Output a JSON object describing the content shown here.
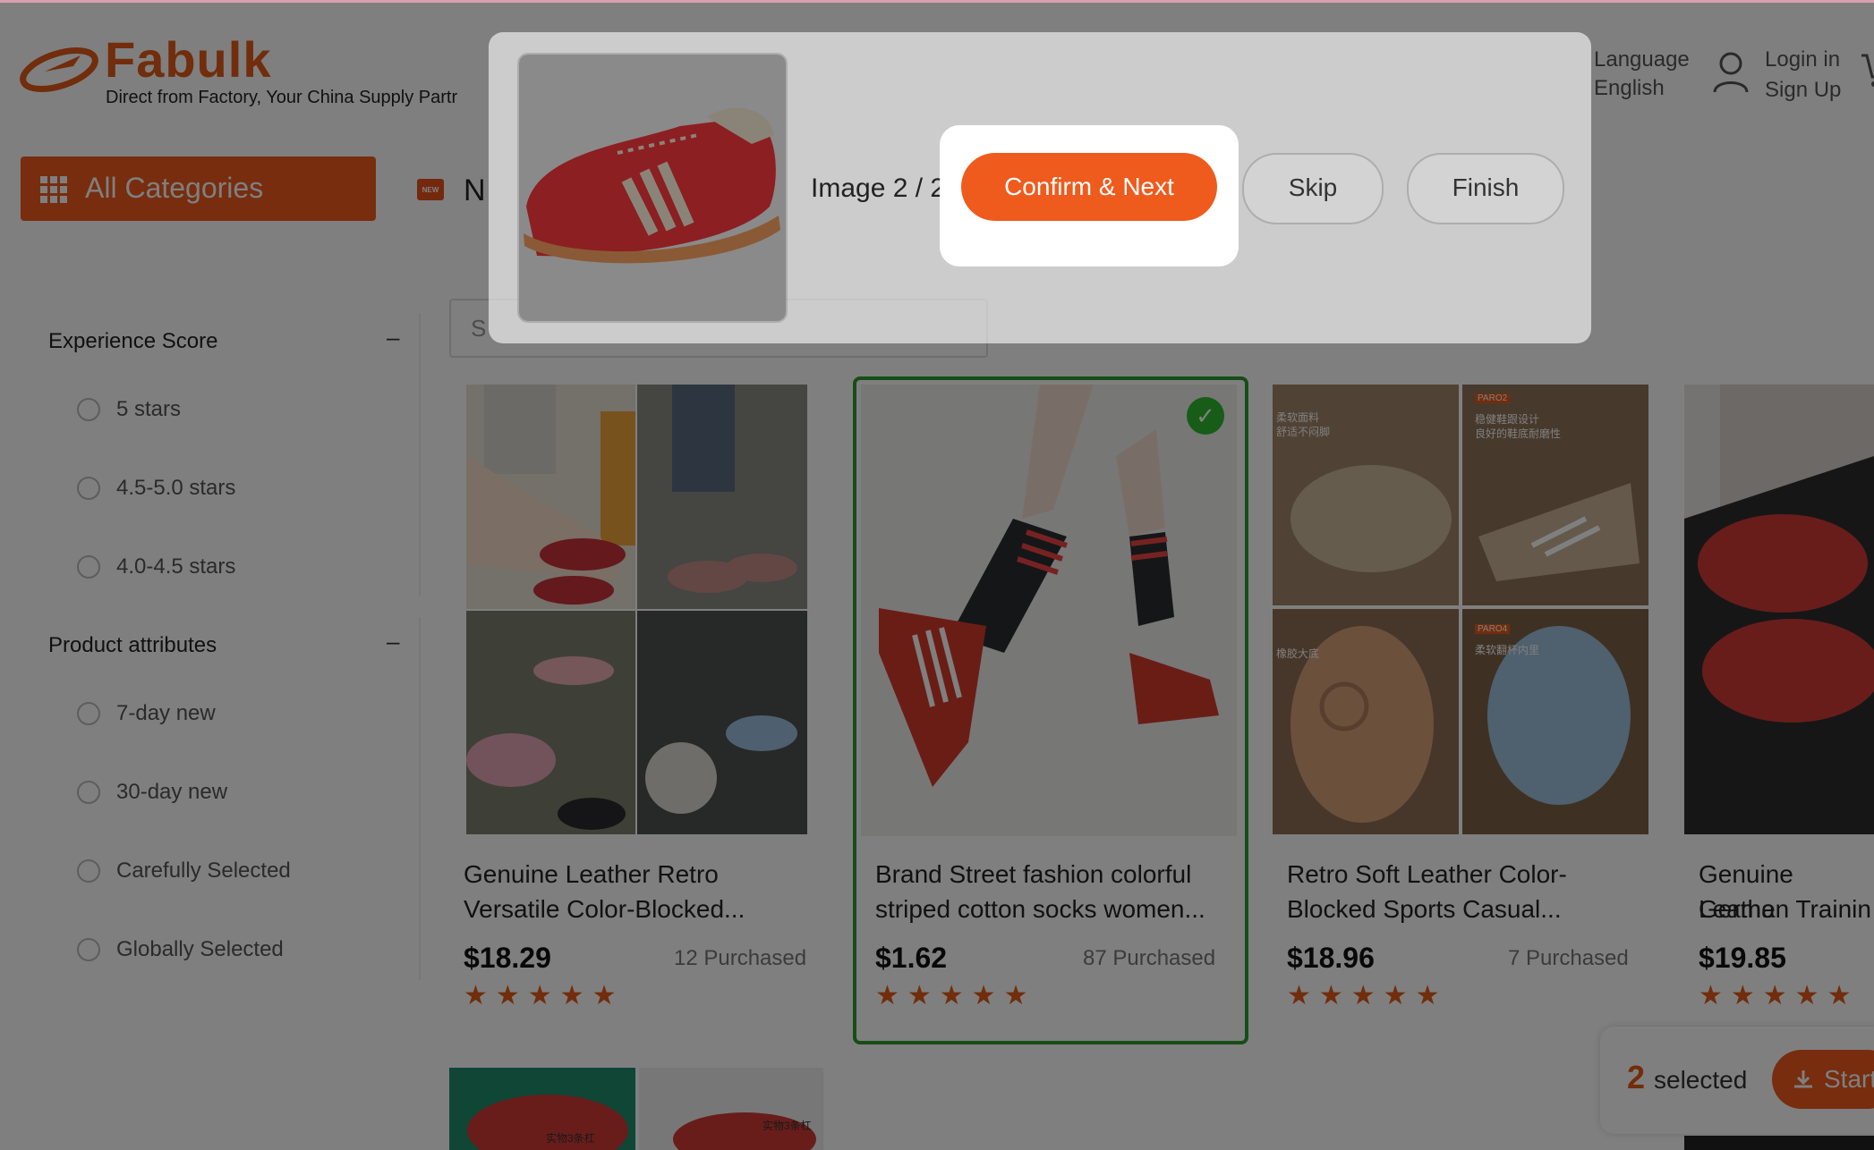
{
  "header": {
    "brand": "Fabulk",
    "tagline": "Direct from Factory, Your China Supply Partr",
    "language_label": "Language",
    "language_value": "English",
    "login": "Login in",
    "signup": "Sign Up"
  },
  "nav": {
    "all_categories": "All Categories",
    "new_badge": "NEW",
    "partial_item": "N"
  },
  "sidebar": {
    "groups": [
      {
        "title": "Experience Score",
        "collapse": "–",
        "options": [
          "5 stars",
          "4.5-5.0 stars",
          "4.0-4.5 stars"
        ]
      },
      {
        "title": "Product attributes",
        "collapse": "–",
        "options": [
          "7-day new",
          "30-day new",
          "Carefully Selected",
          "Globally Selected"
        ]
      }
    ]
  },
  "search": {
    "placeholder": "S"
  },
  "products": [
    {
      "title_1": "Genuine Leather Retro",
      "title_2": "Versatile Color-Blocked...",
      "price": "$18.29",
      "purchased": "12 Purchased",
      "rating": 5
    },
    {
      "title_1": "Brand Street fashion colorful",
      "title_2": "striped cotton socks women...",
      "price": "$1.62",
      "purchased": "87 Purchased",
      "rating": 5,
      "selected": true,
      "check": "✓"
    },
    {
      "title_1": "Retro Soft Leather Color-",
      "title_2": "Blocked Sports Casual...",
      "price": "$18.96",
      "purchased": "7 Purchased",
      "rating": 5
    },
    {
      "title_1": "Genuine Leathe",
      "title_2": "German Trainin",
      "price": "$19.85",
      "rating": 5
    }
  ],
  "product_image_text": {
    "p3_tags": [
      "柔软面料",
      "舒适不闷脚",
      "PARO2",
      "稳健鞋跟设计",
      "良好的鞋底耐磨性",
      "橡胶大底",
      "PARO4",
      "柔软翻杯内里"
    ],
    "row2_tags": [
      "实物3条杠",
      "实物3条杠"
    ]
  },
  "selection_bar": {
    "count": "2",
    "label": "selected",
    "start": "Start"
  },
  "modal": {
    "image_counter": "Image 2 / 2",
    "confirm_label": "Confirm & Next",
    "skip_label": "Skip",
    "finish_label": "Finish"
  },
  "colors": {
    "accent": "#ef5a1d",
    "brand": "#e35a18",
    "selected_border": "#2e9a2e",
    "check": "#2eb82e"
  },
  "icons": [
    "plane-logo-icon",
    "user-icon",
    "cart-icon",
    "grid-icon",
    "new-badge-icon",
    "minus-icon",
    "radio-icon",
    "star-icon",
    "check-icon",
    "download-icon"
  ]
}
